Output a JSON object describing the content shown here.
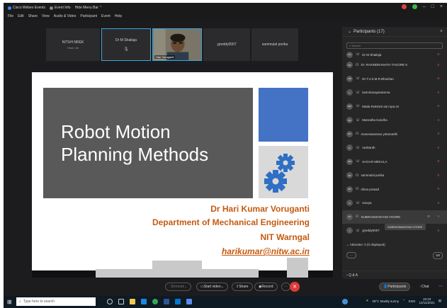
{
  "titlebar": {
    "app": "Cisco Webex Events",
    "event_info": "Event Info",
    "hide_menu": "Hide Menu Bar ⌃"
  },
  "menu": [
    "File",
    "Edit",
    "Share",
    "View",
    "Audio & Video",
    "Participant",
    "Event",
    "Help"
  ],
  "video_tiles": [
    {
      "name": "NITUH NREK",
      "sub": "Host, me"
    },
    {
      "name": "Dr M Shailaja",
      "sub": ""
    },
    {
      "name": "Hari Voruganti",
      "sub": ""
    },
    {
      "name": "yjreddy0007",
      "sub": ""
    },
    {
      "name": "sammulal porika",
      "sub": ""
    }
  ],
  "slide": {
    "title_line1": "Robot Motion",
    "title_line2": "Planning Methods",
    "author": "Dr Hari Kumar Voruganti",
    "department": "Department of Mechanical Engineering",
    "institute": "NIT Warngal",
    "email": "harikumar@nitw.ac.in"
  },
  "panel": {
    "title": "Participants (17)",
    "search_placeholder": "Search",
    "participants": [
      {
        "initials": "DS",
        "name": "Dr M Shailaja"
      },
      {
        "initials": "DK",
        "name": "Dr. RAVINDRANATH TAGORE K"
      },
      {
        "initials": "DB",
        "name": "Dr.T.V.S.M.R.Bhushan"
      },
      {
        "initials": "L",
        "name": "laxminarayanamma"
      },
      {
        "initials": "MR",
        "name": "Mada Rukmini sai rupa sri"
      },
      {
        "initials": "MK",
        "name": "Mamatha Kandha"
      },
      {
        "initials": "MY",
        "name": "maneswararao yelamarthi"
      },
      {
        "initials": "R",
        "name": "ravikanth"
      },
      {
        "initials": "SM",
        "name": "SAGAR MEKALA"
      },
      {
        "initials": "SP",
        "name": "sammulal porika"
      },
      {
        "initials": "SP",
        "name": "shiva prasad"
      },
      {
        "initials": "S",
        "name": "sravya"
      },
      {
        "initials": "SV",
        "name": "SUBRAHMANYAM VOORE"
      },
      {
        "initials": "Y",
        "name": "yjreddy0007"
      }
    ],
    "tooltip": "SUBRAHMANYAM VOORE",
    "attendee_label": "Attendee: 0 (0 displayed)",
    "qa_label": "Q & A"
  },
  "controls": {
    "unmute": "Unmute",
    "start_video": "Start video",
    "share": "Share",
    "record": "Record",
    "participants": "Participants",
    "chat": "Chat"
  },
  "taskbar": {
    "search_placeholder": "Type here to search",
    "weather": "28°C Mostly sunny",
    "lang": "ENG",
    "time": "15:23",
    "date": "12/11/2021"
  }
}
